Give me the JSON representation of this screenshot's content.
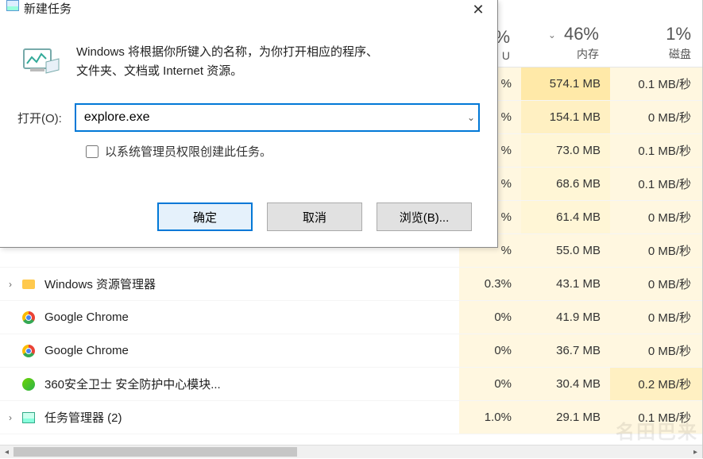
{
  "dialog": {
    "title": "新建任务",
    "description_line1": "Windows 将根据你所键入的名称，为你打开相应的程序、",
    "description_line2": "文件夹、文档或 Internet 资源。",
    "open_label": "打开(O):",
    "open_value": "explore.exe",
    "admin_label": "以系统管理员权限创建此任务。",
    "ok": "确定",
    "cancel": "取消",
    "browse": "浏览(B)..."
  },
  "taskmgr": {
    "columns": {
      "cpu_pct": "%",
      "mem_pct": "46%",
      "mem_label": "内存",
      "disk_pct": "1%",
      "disk_label": "磁盘",
      "cpu_end": "U"
    },
    "rows": [
      {
        "name": "",
        "cpu": "%",
        "mem": "574.1 MB",
        "disk": "0.1 MB/秒",
        "icon": "",
        "mem_shade": 1,
        "exp": ""
      },
      {
        "name": "",
        "cpu": "%",
        "mem": "154.1 MB",
        "disk": "0 MB/秒",
        "icon": "",
        "mem_shade": 2,
        "exp": ""
      },
      {
        "name": "",
        "cpu": "%",
        "mem": "73.0 MB",
        "disk": "0.1 MB/秒",
        "icon": "",
        "mem_shade": 3,
        "exp": ""
      },
      {
        "name": "",
        "cpu": "%",
        "mem": "68.6 MB",
        "disk": "0.1 MB/秒",
        "icon": "",
        "mem_shade": 3,
        "exp": ""
      },
      {
        "name": "",
        "cpu": "%",
        "mem": "61.4 MB",
        "disk": "0 MB/秒",
        "icon": "",
        "mem_shade": 3,
        "exp": ""
      },
      {
        "name": "",
        "cpu": "%",
        "mem": "55.0 MB",
        "disk": "0 MB/秒",
        "icon": "",
        "mem_shade": 4,
        "exp": ""
      },
      {
        "name": "Windows 资源管理器",
        "cpu": "0.3%",
        "mem": "43.1 MB",
        "disk": "0 MB/秒",
        "icon": "folder",
        "mem_shade": 4,
        "exp": "›"
      },
      {
        "name": "Google Chrome",
        "cpu": "0%",
        "mem": "41.9 MB",
        "disk": "0 MB/秒",
        "icon": "chrome",
        "mem_shade": 4,
        "exp": ""
      },
      {
        "name": "Google Chrome",
        "cpu": "0%",
        "mem": "36.7 MB",
        "disk": "0 MB/秒",
        "icon": "chrome",
        "mem_shade": 4,
        "exp": ""
      },
      {
        "name": "360安全卫士 安全防护中心模块...",
        "cpu": "0%",
        "mem": "30.4 MB",
        "disk": "0.2 MB/秒",
        "icon": "360",
        "mem_shade": 4,
        "exp": "",
        "disk_shade": 1
      },
      {
        "name": "任务管理器 (2)",
        "cpu": "1.0%",
        "mem": "29.1 MB",
        "disk": "0.1 MB/秒",
        "icon": "tm",
        "mem_shade": 4,
        "exp": "›"
      }
    ]
  }
}
